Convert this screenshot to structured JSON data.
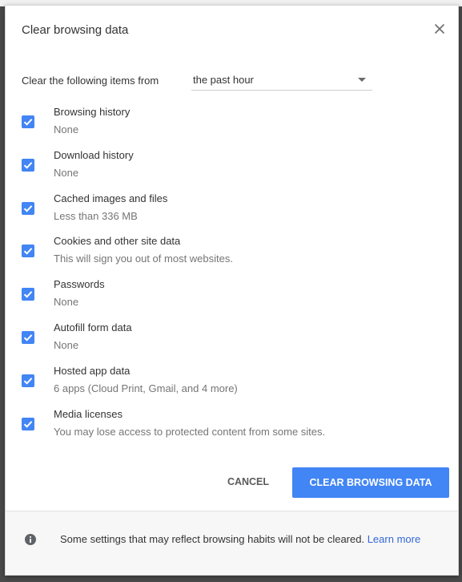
{
  "dialog": {
    "title": "Clear browsing data",
    "close_icon": "close-icon"
  },
  "range": {
    "label": "Clear the following items from",
    "selected": "the past hour"
  },
  "items": [
    {
      "title": "Browsing history",
      "subtitle": "None",
      "checked": true
    },
    {
      "title": "Download history",
      "subtitle": "None",
      "checked": true
    },
    {
      "title": "Cached images and files",
      "subtitle": "Less than 336 MB",
      "checked": true
    },
    {
      "title": "Cookies and other site data",
      "subtitle": "This will sign you out of most websites.",
      "checked": true
    },
    {
      "title": "Passwords",
      "subtitle": "None",
      "checked": true
    },
    {
      "title": "Autofill form data",
      "subtitle": "None",
      "checked": true
    },
    {
      "title": "Hosted app data",
      "subtitle": "6 apps (Cloud Print, Gmail, and 4 more)",
      "checked": true
    },
    {
      "title": "Media licenses",
      "subtitle": "You may lose access to protected content from some sites.",
      "checked": true
    }
  ],
  "buttons": {
    "cancel": "CANCEL",
    "clear": "CLEAR BROWSING DATA"
  },
  "footer": {
    "text": "Some settings that may reflect browsing habits will not be cleared.",
    "link": "Learn more",
    "icon": "info-icon"
  },
  "colors": {
    "accent": "#4285f4",
    "link": "#3367d6",
    "footer_bg": "#f7f7f7"
  }
}
